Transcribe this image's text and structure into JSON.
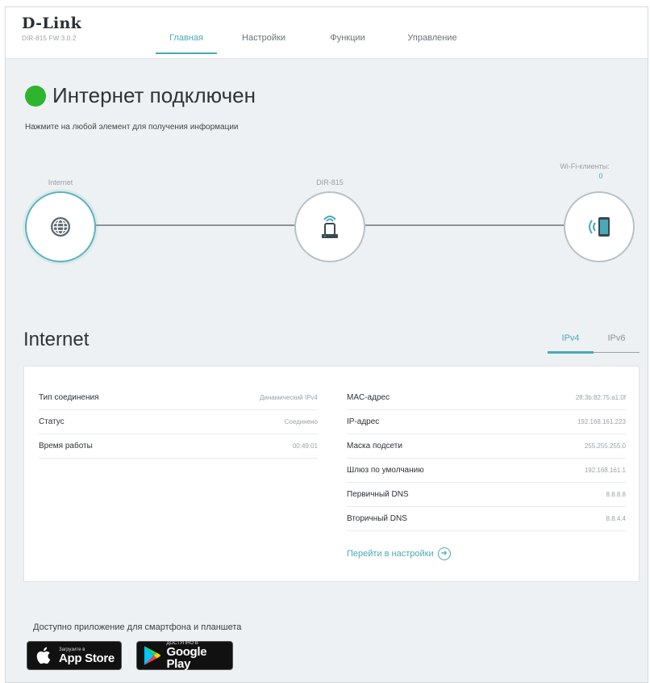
{
  "header": {
    "brand": "D-Link",
    "model": "DIR-815 FW:3.0.2",
    "nav": [
      {
        "label": "Главная",
        "active": true
      },
      {
        "label": "Настройки",
        "active": false
      },
      {
        "label": "Функции",
        "active": false
      },
      {
        "label": "Управление",
        "active": false
      }
    ]
  },
  "status": {
    "title": "Интернет подключен",
    "hint": "Нажмите на любой элемент для получения информации",
    "color": "#2db52d"
  },
  "topology": {
    "internet_label": "Internet",
    "router_label": "DIR-815",
    "clients_label": "Wi-Fi-клиенты:",
    "clients_count": "0"
  },
  "internet": {
    "title": "Internet",
    "tabs": [
      {
        "label": "IPv4",
        "active": true
      },
      {
        "label": "IPv6",
        "active": false
      }
    ],
    "left": [
      {
        "key": "Тип соединения",
        "value": "Динамический IPv4"
      },
      {
        "key": "Статус",
        "value": "Соединено"
      },
      {
        "key": "Время работы",
        "value": "00:49:01"
      }
    ],
    "right": [
      {
        "key": "MAC-адрес",
        "value": "28:3b:82:75:a1:0f"
      },
      {
        "key": "IP-адрес",
        "value": "192.168.161.223"
      },
      {
        "key": "Маска подсети",
        "value": "255.255.255.0"
      },
      {
        "key": "Шлюз по умолчанию",
        "value": "192.168.161.1"
      },
      {
        "key": "Первичный DNS",
        "value": "8.8.8.8"
      },
      {
        "key": "Вторичный DNS",
        "value": "8.8.4.4"
      }
    ],
    "settings_link": "Перейти в настройки"
  },
  "app": {
    "text": "Доступно приложение для смартфона и планшета",
    "appstore_small": "Загрузите в",
    "appstore_big": "App Store",
    "gplay_small": "ДОСТУПНО В",
    "gplay_big": "Google Play"
  },
  "colors": {
    "accent": "#4aa9b8",
    "background": "#eef1f3"
  }
}
